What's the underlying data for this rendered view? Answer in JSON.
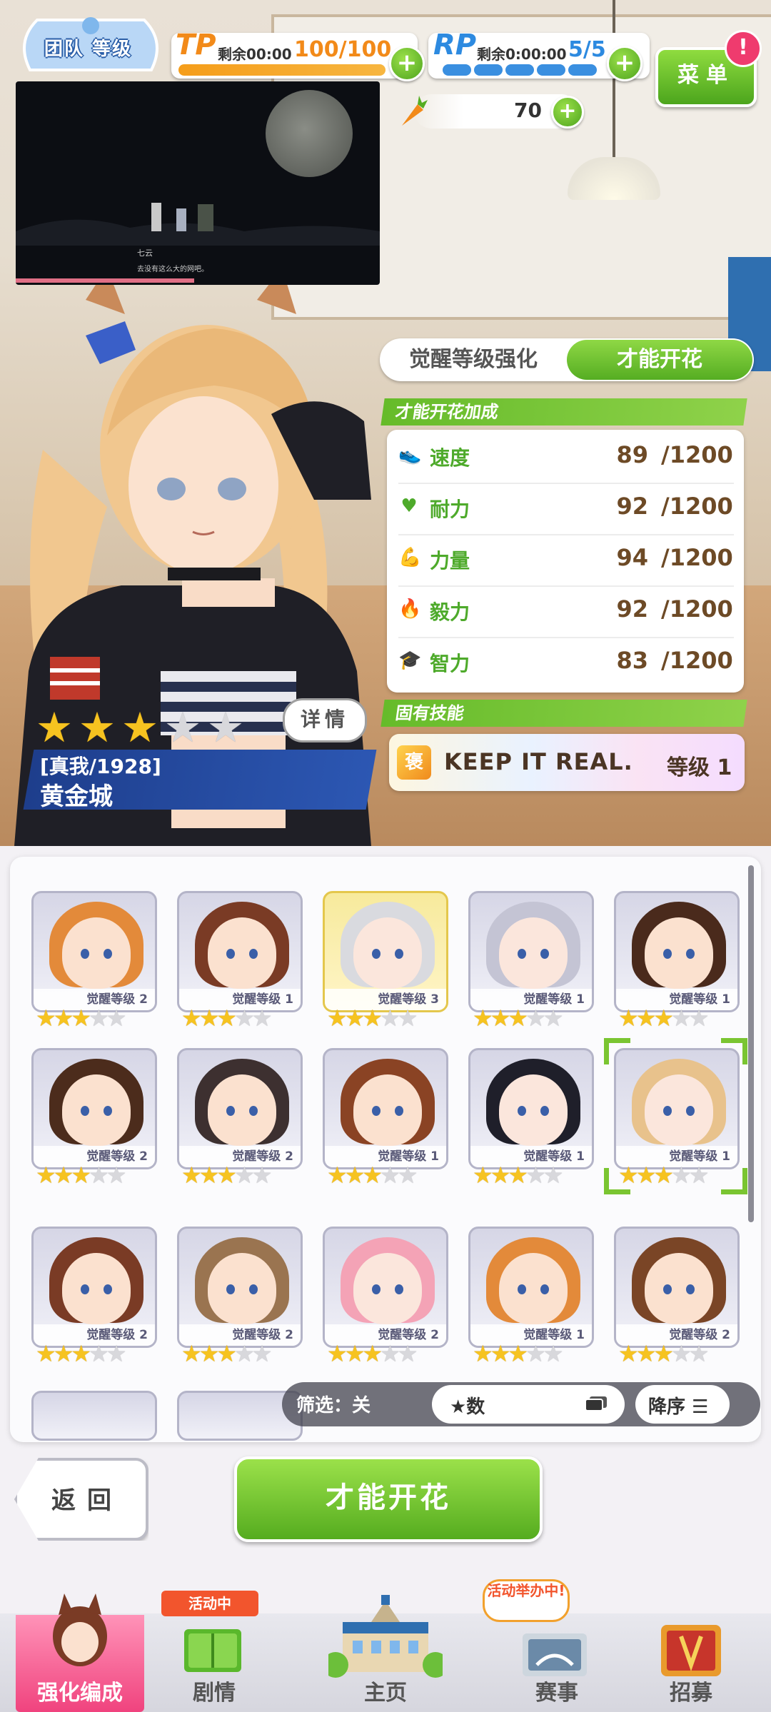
{
  "hud": {
    "team_label": "团队 等级",
    "tp": {
      "tag": "TP",
      "remaining": "剩余00:00",
      "value": "100/100",
      "fill": 1.0
    },
    "rp": {
      "tag": "RP",
      "remaining": "剩余0:00:00",
      "value": "5/5",
      "pills": 5
    },
    "carrots": "70",
    "plus": "+",
    "menu_label": "菜单",
    "alert": "!"
  },
  "video": {
    "speaker": "七云",
    "line": "去没有这么大的网吧。"
  },
  "tabs": {
    "awaken": "觉醒等级强化",
    "bloom": "才能开花"
  },
  "bonus": {
    "header": "才能开花加成",
    "stats": [
      {
        "name": "速度",
        "value": "89",
        "max": "/1200",
        "icon": "shoe-icon"
      },
      {
        "name": "耐力",
        "value": "92",
        "max": "/1200",
        "icon": "heart-icon"
      },
      {
        "name": "力量",
        "value": "94",
        "max": "/1200",
        "icon": "muscle-icon"
      },
      {
        "name": "毅力",
        "value": "92",
        "max": "/1200",
        "icon": "flame-icon"
      },
      {
        "name": "智力",
        "value": "83",
        "max": "/1200",
        "icon": "graduation-cap-icon"
      }
    ]
  },
  "skill": {
    "header": "固有技能",
    "name": "KEEP IT REAL.",
    "level": "等级 1",
    "icon_text": "褒"
  },
  "character": {
    "stars_total": 5,
    "stars_filled": 3,
    "title": "[真我/1928]",
    "name": "黄金城",
    "detail_label": "详情"
  },
  "roster": [
    {
      "level": "觉醒等级 2",
      "stars": 3,
      "hair": "#e38a3a",
      "skin": "#fbe1cf",
      "gold": false
    },
    {
      "level": "觉醒等级 1",
      "stars": 3,
      "hair": "#7a3b25",
      "skin": "#fbe1cf",
      "gold": false
    },
    {
      "level": "觉醒等级 3",
      "stars": 3,
      "hair": "#d9dadf",
      "skin": "#fbe6dc",
      "gold": true
    },
    {
      "level": "觉醒等级 1",
      "stars": 3,
      "hair": "#c4c4d4",
      "skin": "#fbe6dc",
      "gold": false
    },
    {
      "level": "觉醒等级 1",
      "stars": 3,
      "hair": "#4a2a1c",
      "skin": "#fbe1cf",
      "gold": false
    },
    {
      "level": "觉醒等级 2",
      "stars": 3,
      "hair": "#4c2c1c",
      "skin": "#fbe1cf",
      "gold": false
    },
    {
      "level": "觉醒等级 2",
      "stars": 3,
      "hair": "#3d3030",
      "skin": "#fbe1cf",
      "gold": false
    },
    {
      "level": "觉醒等级 1",
      "stars": 3,
      "hair": "#8a4324",
      "skin": "#fbe1cf",
      "gold": false
    },
    {
      "level": "觉醒等级 1",
      "stars": 3,
      "hair": "#1f1f2a",
      "skin": "#fbe6dc",
      "gold": false
    },
    {
      "level": "觉醒等级 1",
      "stars": 3,
      "hair": "#e8c28c",
      "skin": "#fbe6dc",
      "gold": false
    },
    {
      "level": "觉醒等级 2",
      "stars": 3,
      "hair": "#7a3b25",
      "skin": "#fbe1cf",
      "gold": false
    },
    {
      "level": "觉醒等级 2",
      "stars": 3,
      "hair": "#9a7450",
      "skin": "#fbe1cf",
      "gold": false
    },
    {
      "level": "觉醒等级 2",
      "stars": 3,
      "hair": "#f4a3b6",
      "skin": "#fbe6dc",
      "gold": false
    },
    {
      "level": "觉醒等级 1",
      "stars": 3,
      "hair": "#e38a3a",
      "skin": "#fbe1cf",
      "gold": false
    },
    {
      "level": "觉醒等级 2",
      "stars": 3,
      "hair": "#7a4526",
      "skin": "#fbe1cf",
      "gold": false
    }
  ],
  "filter": {
    "label": "筛选：关",
    "sort": "★数",
    "order": "降序"
  },
  "actions": {
    "back": "返回",
    "bloom": "才能开花"
  },
  "nav": [
    {
      "label": "强化编成",
      "icon": "horse-girl-icon",
      "active": true
    },
    {
      "label": "剧情",
      "icon": "story-book-icon",
      "badge": "活动中"
    },
    {
      "label": "主页",
      "icon": "school-building-icon"
    },
    {
      "label": "赛事",
      "icon": "race-icon",
      "badge": "活动举办中!"
    },
    {
      "label": "招募",
      "icon": "scout-icon"
    }
  ],
  "colors": {
    "accent_green": "#55ad22",
    "tp_orange": "#f28a19",
    "rp_blue": "#2d8ae0",
    "name_blue": "#1e3e8c",
    "nav_active": "#f0437e"
  }
}
